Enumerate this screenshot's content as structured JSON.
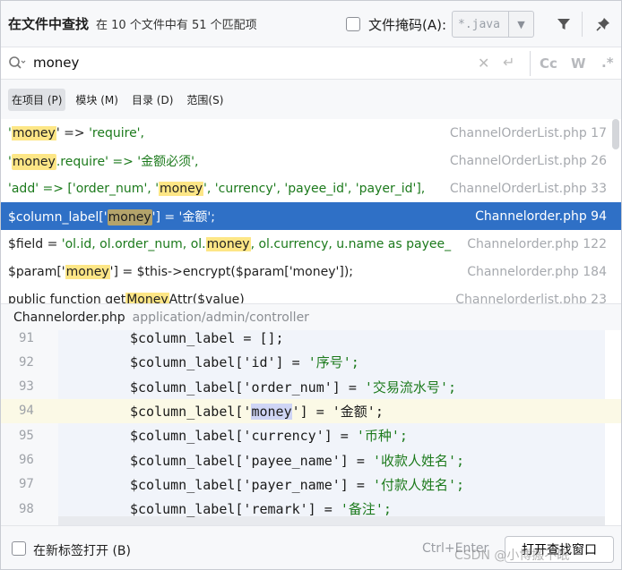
{
  "header": {
    "title": "在文件中查找",
    "subtitle": "在 10 个文件中有 51 个匹配项",
    "file_mask_label": "文件掩码(A):",
    "file_mask_value": "*.java",
    "dropdown_icon": "chevron-down-icon",
    "filter_icon": "filter-icon",
    "pin_icon": "pin-icon"
  },
  "search": {
    "query": "money",
    "case_label": "Cc",
    "words_label": "W",
    "regex_label": ".*"
  },
  "scopes": [
    {
      "label": "在项目 (P)",
      "active": true
    },
    {
      "label": "模块 (M)",
      "active": false
    },
    {
      "label": "目录 (D)",
      "active": false
    },
    {
      "label": "范围(S)",
      "active": false
    }
  ],
  "results": [
    {
      "parts": [
        {
          "t": "'",
          "c": "str"
        },
        {
          "t": "money",
          "c": "hl"
        },
        {
          "t": "'  => ",
          "c": ""
        },
        {
          "t": "'require',",
          "c": "str"
        }
      ],
      "file": "ChannelOrderList.php 17",
      "selected": false
    },
    {
      "parts": [
        {
          "t": "'",
          "c": "str"
        },
        {
          "t": "money",
          "c": "hl"
        },
        {
          "t": ".require' => ",
          "c": "str"
        },
        {
          "t": "'金额必须',",
          "c": "str"
        }
      ],
      "file": "ChannelOrderList.php 26",
      "selected": false
    },
    {
      "parts": [
        {
          "t": "'add'  =>  [",
          "c": "str"
        },
        {
          "t": "'order_num', '",
          "c": "str"
        },
        {
          "t": "money",
          "c": "hl"
        },
        {
          "t": "', 'currency', 'payee_id', 'payer_id'],",
          "c": "str"
        }
      ],
      "file": "ChannelOrderList.php 33",
      "selected": false
    },
    {
      "parts": [
        {
          "t": "$column_label['",
          "c": ""
        },
        {
          "t": "money",
          "c": "hl"
        },
        {
          "t": "'] = '金额';",
          "c": ""
        }
      ],
      "file": "Channelorder.php 94",
      "selected": true
    },
    {
      "parts": [
        {
          "t": "$field = ",
          "c": ""
        },
        {
          "t": "'ol.id, ol.order_num, ol.",
          "c": "str"
        },
        {
          "t": "money",
          "c": "hl"
        },
        {
          "t": ", ol.currency, u.name as payee_",
          "c": "str"
        }
      ],
      "file": "Channelorder.php 122",
      "selected": false
    },
    {
      "parts": [
        {
          "t": "$param['",
          "c": ""
        },
        {
          "t": "money",
          "c": "hl"
        },
        {
          "t": "'] = $this->encrypt($param['money']);",
          "c": ""
        }
      ],
      "file": "Channelorder.php 184",
      "selected": false
    },
    {
      "parts": [
        {
          "t": "public function get",
          "c": ""
        },
        {
          "t": "Money",
          "c": "hl"
        },
        {
          "t": "Attr($value)",
          "c": ""
        }
      ],
      "file": "Channelorderlist.php 23",
      "selected": false
    }
  ],
  "preview": {
    "file": "Channelorder.php",
    "path": "application/admin/controller",
    "lines": [
      {
        "num": "91",
        "pre": "$column_label = [];",
        "mid": "",
        "post": "",
        "current": false
      },
      {
        "num": "92",
        "pre": "$column_label['id'] = ",
        "mid": "",
        "post": "'序号';",
        "current": false
      },
      {
        "num": "93",
        "pre": "$column_label['order_num'] = ",
        "mid": "",
        "post": "'交易流水号';",
        "current": false
      },
      {
        "num": "94",
        "pre": "$column_label['",
        "mid": "money",
        "post": "'] = '金额';",
        "current": true
      },
      {
        "num": "95",
        "pre": "$column_label['currency'] = ",
        "mid": "",
        "post": "'币种';",
        "current": false
      },
      {
        "num": "96",
        "pre": "$column_label['payee_name'] = ",
        "mid": "",
        "post": "'收款人姓名';",
        "current": false
      },
      {
        "num": "97",
        "pre": "$column_label['payer_name'] = ",
        "mid": "",
        "post": "'付款人姓名';",
        "current": false
      },
      {
        "num": "98",
        "pre": "$column_label['remark'] = ",
        "mid": "",
        "post": "'备注';",
        "current": false
      }
    ]
  },
  "footer": {
    "open_in_new_tab": "在新标签打开 (B)",
    "shortcut": "Ctrl+Enter",
    "open_button": "打开查找窗口"
  },
  "watermark": "CSDN @小博搬不眠"
}
